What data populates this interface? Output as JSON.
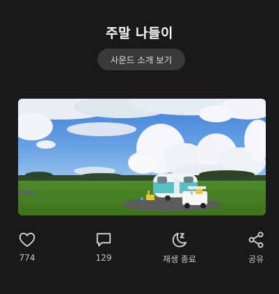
{
  "header": {
    "title": "주말 나들이",
    "sound_button_label": "사운드 소개 보기"
  },
  "photo": {
    "scene": "camper-trailer-field-image"
  },
  "actions": [
    {
      "icon": "heart-icon",
      "label": "774"
    },
    {
      "icon": "comment-icon",
      "label": "129"
    },
    {
      "icon": "moon-sleep-icon",
      "label": "재생 종료"
    },
    {
      "icon": "share-icon",
      "label": "공유"
    }
  ],
  "colors": {
    "background": "#1a181b",
    "button_background": "#3b393c",
    "icon": "#d9d9d9"
  }
}
